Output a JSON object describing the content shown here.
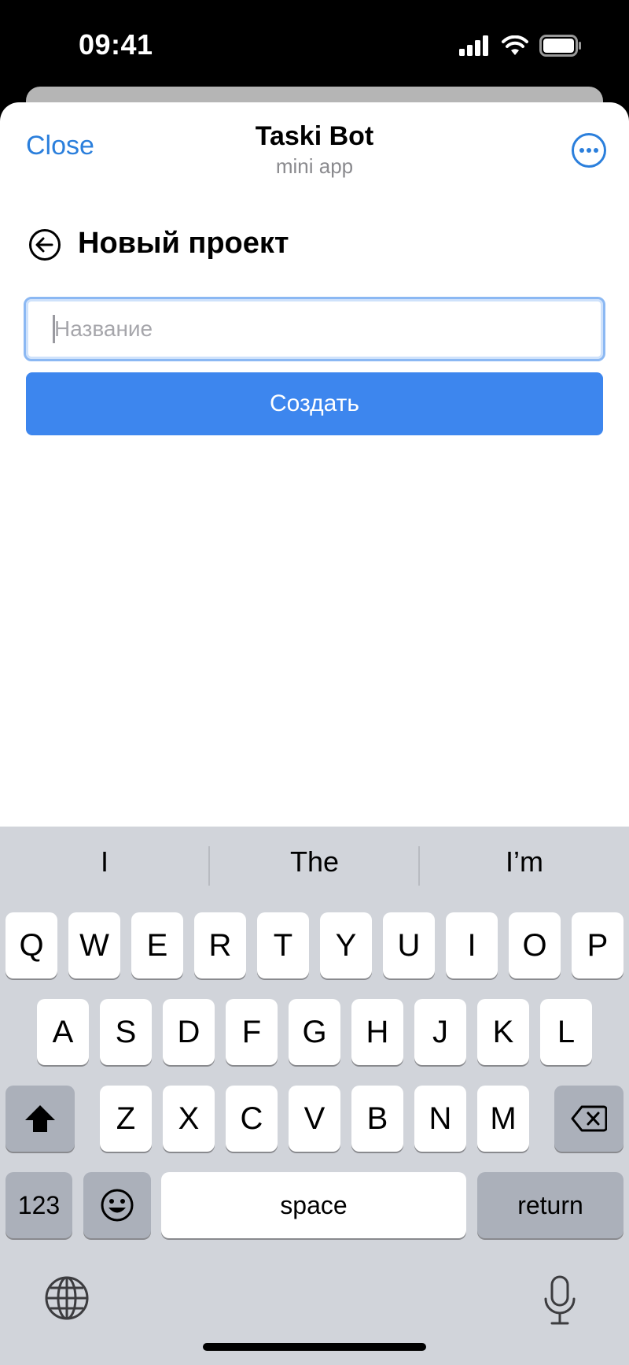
{
  "status_bar": {
    "time": "09:41"
  },
  "header": {
    "close_label": "Close",
    "title": "Taski Bot",
    "subtitle": "mini app"
  },
  "page": {
    "title": "Новый проект"
  },
  "form": {
    "name_placeholder": "Название",
    "name_value": "",
    "create_label": "Создать"
  },
  "keyboard": {
    "predictions": [
      "I",
      "The",
      "I’m"
    ],
    "row1": [
      "Q",
      "W",
      "E",
      "R",
      "T",
      "Y",
      "U",
      "I",
      "O",
      "P"
    ],
    "row2": [
      "A",
      "S",
      "D",
      "F",
      "G",
      "H",
      "J",
      "K",
      "L"
    ],
    "row3": [
      "Z",
      "X",
      "C",
      "V",
      "B",
      "N",
      "M"
    ],
    "numbers_label": "123",
    "space_label": "space",
    "return_label": "return"
  },
  "colors": {
    "accent": "#2b7fdc",
    "button": "#3d86ee",
    "keyboard_bg": "#d1d4da"
  },
  "icons": [
    "signal-icon",
    "wifi-icon",
    "battery-icon",
    "more-icon",
    "back-arrow-icon",
    "shift-icon",
    "delete-icon",
    "emoji-icon",
    "globe-icon",
    "microphone-icon"
  ]
}
